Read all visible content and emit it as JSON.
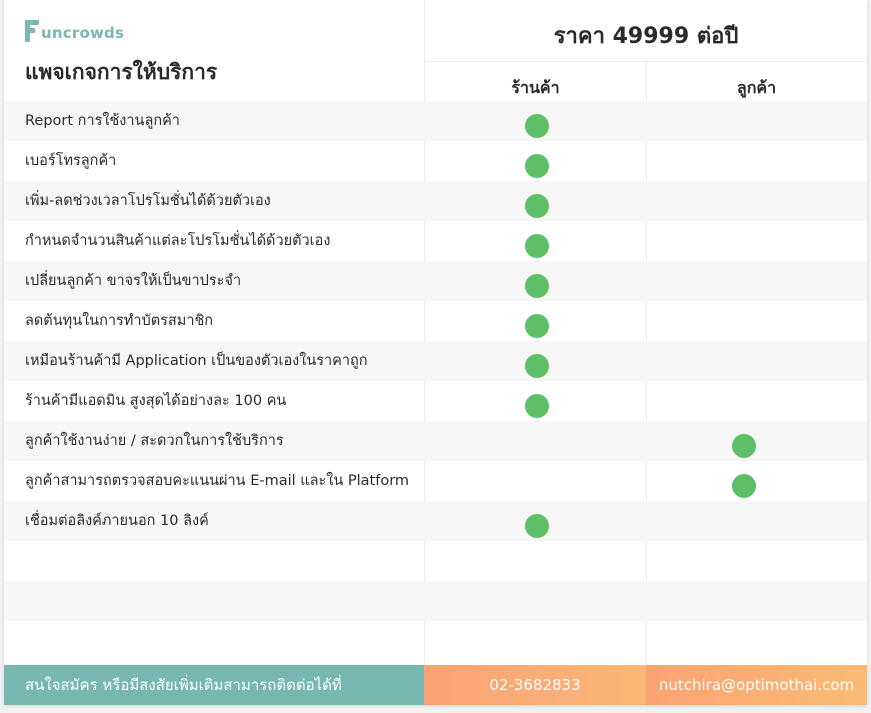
{
  "brand": {
    "logo_text": "uncrowds",
    "color": "#7ab8b1"
  },
  "table": {
    "title": "แพจเกจการให้บริการ",
    "price_header": "ราคา 49999 ต่อปี",
    "columns": [
      "ร้านค้า",
      "ลูกค้า"
    ],
    "check_color": "#5fbf68",
    "features": [
      {
        "label": "Report การใช้งานลูกค้า",
        "store": true,
        "customer": false
      },
      {
        "label": "เบอร์โทรลูกค้า",
        "store": true,
        "customer": false
      },
      {
        "label": "เพิ่ม-ลดช่วงเวลาโปรโมชั่นได้ด้วยตัวเอง",
        "store": true,
        "customer": false
      },
      {
        "label": "กำหนดจำนวนสินค้าแต่ละโปรโมชั่นได้ด้วยตัวเอง",
        "store": true,
        "customer": false
      },
      {
        "label": "เปลี่ยนลูกค้า ขาจรให้เป็นขาประจำ",
        "store": true,
        "customer": false
      },
      {
        "label": "ลดต้นทุนในการทำบัตรสมาชิก",
        "store": true,
        "customer": false
      },
      {
        "label": "เหมือนร้านค้ามี Application เป็นของตัวเองในราคาถูก",
        "store": true,
        "customer": false
      },
      {
        "label": "ร้านค้ามีแอดมิน สูงสุดได้อย่างละ 100 คน",
        "store": true,
        "customer": false
      },
      {
        "label": "ลูกค้าใช้งานง่าย / สะดวกในการใช้บริการ",
        "store": false,
        "customer": true
      },
      {
        "label": "ลูกค้าสามารถตรวจสอบคะแนนผ่าน E-mail และใน Platform",
        "store": false,
        "customer": true
      },
      {
        "label": "เชื่อมต่อลิงค์ภายนอก 10 ลิงค์",
        "store": true,
        "customer": false
      },
      {
        "label": "",
        "store": false,
        "customer": false
      },
      {
        "label": "",
        "store": false,
        "customer": false
      },
      {
        "label": "",
        "store": false,
        "customer": false
      }
    ]
  },
  "footer": {
    "note": "สนใจสมัคร หรือมีสงสัยเพิ่มเติมสามารถติดต่อได้ที่",
    "phone": "02-3682833",
    "email": "nutchira@optimothai.com",
    "note_color": "#76b8b0",
    "contact_color": "#fbab75"
  }
}
